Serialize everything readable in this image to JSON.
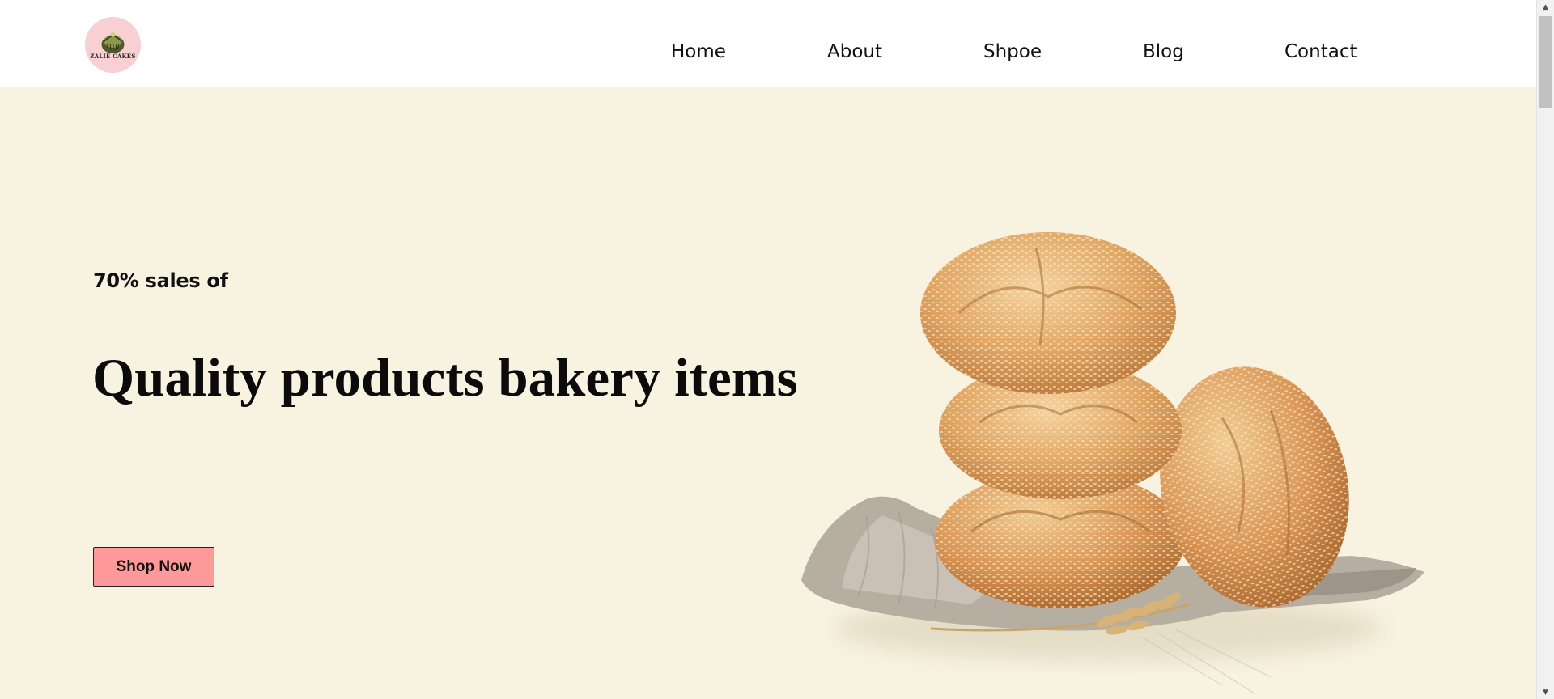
{
  "header": {
    "logo_text": "ZALIE CAKES",
    "nav": [
      {
        "label": "Home"
      },
      {
        "label": "About"
      },
      {
        "label": "Shpoe"
      },
      {
        "label": "Blog"
      },
      {
        "label": "Contact"
      }
    ]
  },
  "hero": {
    "sale_text": "70% sales of",
    "headline": "Quality products bakery items",
    "cta_label": "Shop Now",
    "image_icon": "bread-rolls-image"
  },
  "colors": {
    "hero_bg": "#f8f3e1",
    "button_bg": "#fe9999",
    "logo_bg": "#f8cfd2",
    "text": "#111111"
  },
  "scrollbar": {
    "up_arrow": "▲",
    "down_arrow": "▼"
  }
}
